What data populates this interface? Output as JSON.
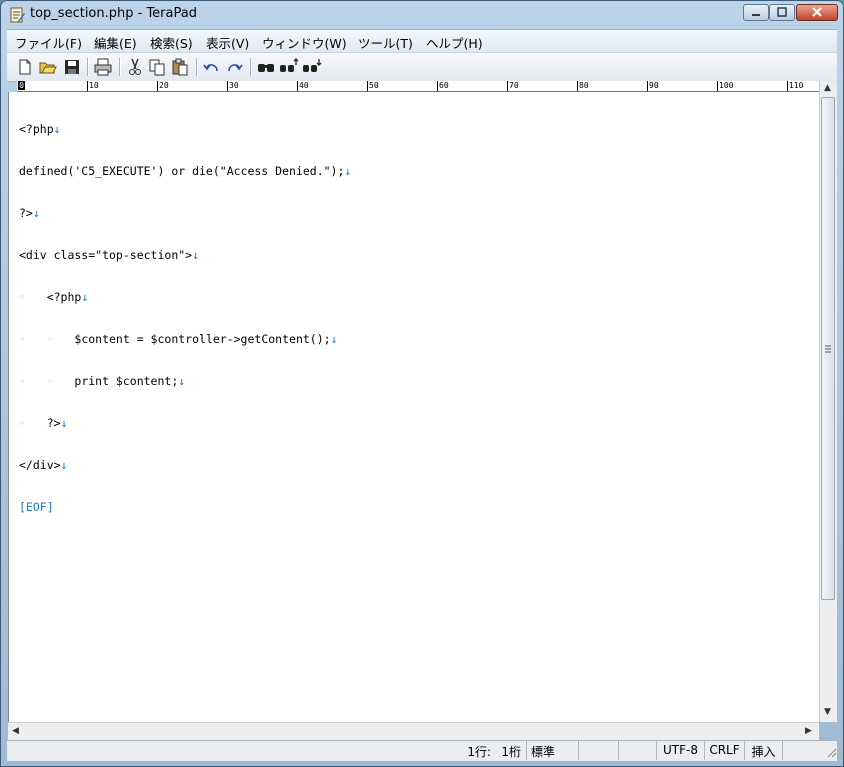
{
  "window": {
    "title": "top_section.php - TeraPad"
  },
  "menu": [
    {
      "label": "ファイル(F)"
    },
    {
      "label": "編集(E)"
    },
    {
      "label": "検索(S)"
    },
    {
      "label": "表示(V)"
    },
    {
      "label": "ウィンドウ(W)"
    },
    {
      "label": "ツール(T)"
    },
    {
      "label": "ヘルプ(H)"
    }
  ],
  "toolbar": {
    "buttons": [
      "new-file-icon",
      "open-folder-icon",
      "save-icon",
      "print-icon",
      "cut-icon",
      "copy-icon",
      "paste-icon",
      "undo-icon",
      "redo-icon",
      "find-icon",
      "find-next-icon",
      "find-prev-icon"
    ]
  },
  "ruler": {
    "zero": "0",
    "marks": [
      "10",
      "20",
      "30",
      "40",
      "50",
      "60",
      "70",
      "80",
      "90",
      "100",
      "110"
    ]
  },
  "editor": {
    "lines": [
      "<?php",
      "defined('C5_EXECUTE') or die(\"Access Denied.\");",
      "?>",
      "<div class=\"top-section\">",
      "<?php",
      "$content = $controller->getContent();",
      "print $content;",
      "?>",
      "</div>"
    ],
    "eof": "[EOF]"
  },
  "status": {
    "line": "1行:",
    "column": "1桁",
    "mode": "標準",
    "encoding": "UTF-8",
    "newline": "CRLF",
    "insert": "挿入"
  }
}
